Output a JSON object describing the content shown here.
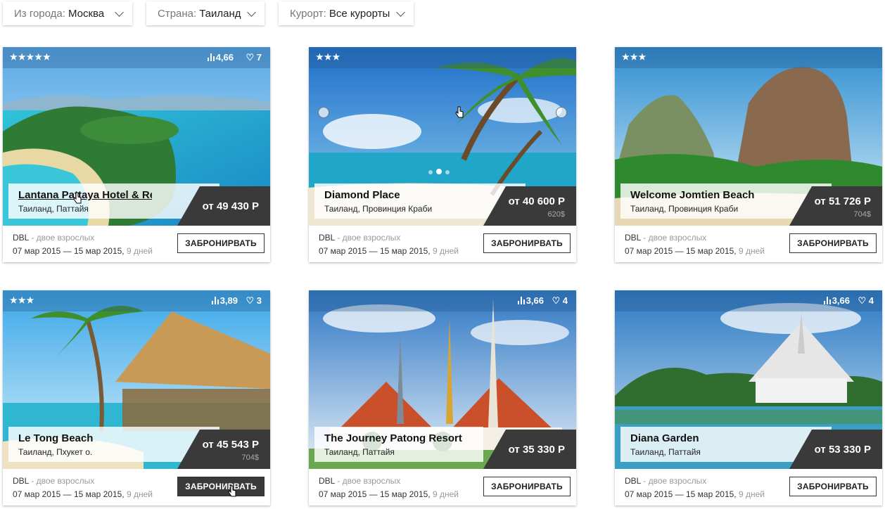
{
  "filters": [
    {
      "label": "Из города:",
      "value": "Москва"
    },
    {
      "label": "Страна:",
      "value": "Таиланд"
    },
    {
      "label": "Курорт:",
      "value": "Все курорты"
    }
  ],
  "cards": [
    {
      "stars": "★★★★★",
      "rating": "4,66",
      "likes": "7",
      "name": "Lantana Pattaya Hotel & Re",
      "location": "Таиланд, Паттайя",
      "price": "от 49 430 Р",
      "usd": "",
      "room": "DBL",
      "guests": " - двое взрослых",
      "dates": "07 мар 2015 — 15 мар 2015,",
      "nights": " 9 дней",
      "book": "ЗАБРОНИРВАТЬ"
    },
    {
      "stars": "★★★",
      "rating": "",
      "likes": "",
      "name": "Diamond Place",
      "location": "Таиланд, Провинция Краби",
      "price": "от 40 600 Р",
      "usd": "620$",
      "room": "DBL",
      "guests": " - двое взрослых",
      "dates": "07 мар 2015 — 15 мар 2015,",
      "nights": " 9 дней",
      "book": "ЗАБРОНИРВАТЬ"
    },
    {
      "stars": "★★★",
      "rating": "",
      "likes": "",
      "name": "Welcome Jomtien Beach",
      "location": "Таиланд, Провинция Краби",
      "price": "от 51 726 Р",
      "usd": "704$",
      "room": "DBL",
      "guests": " - двое взрослых",
      "dates": "07 мар 2015 — 15 мар 2015,",
      "nights": " 9 дней",
      "book": "ЗАБРОНИРВАТЬ"
    },
    {
      "stars": "★★★",
      "rating": "3,89",
      "likes": "3",
      "name": "Le Tong Beach",
      "location": "Таиланд, Пхукет о.",
      "price": "от 45 543 Р",
      "usd": "704$",
      "room": "DBL",
      "guests": " - двое взрослых",
      "dates": "07 мар 2015 — 15 мар 2015,",
      "nights": " 9 дней",
      "book": "ЗАБРОНИРВАТЬ"
    },
    {
      "stars": "",
      "rating": "3,66",
      "likes": "4",
      "name": "The Journey Patong Resort",
      "location": "Таиланд, Паттайя",
      "price": "от 35 330 Р",
      "usd": "",
      "room": "DBL",
      "guests": " - двое взрослых",
      "dates": "07 мар 2015 — 15 мар 2015,",
      "nights": " 9 дней",
      "book": "ЗАБРОНИРВАТЬ"
    },
    {
      "stars": "",
      "rating": "3,66",
      "likes": "4",
      "name": "Diana Garden",
      "location": "Таиланд, Паттайя",
      "price": "от 53 330 Р",
      "usd": "",
      "room": "DBL",
      "guests": " - двое взрослых",
      "dates": "07 мар 2015 — 15 мар 2015,",
      "nights": " 9 дней",
      "book": "ЗАБРОНИРВАТЬ"
    }
  ],
  "colors": {
    "price_bg": "#3a3a3a",
    "accent": "#2a8fd6"
  }
}
